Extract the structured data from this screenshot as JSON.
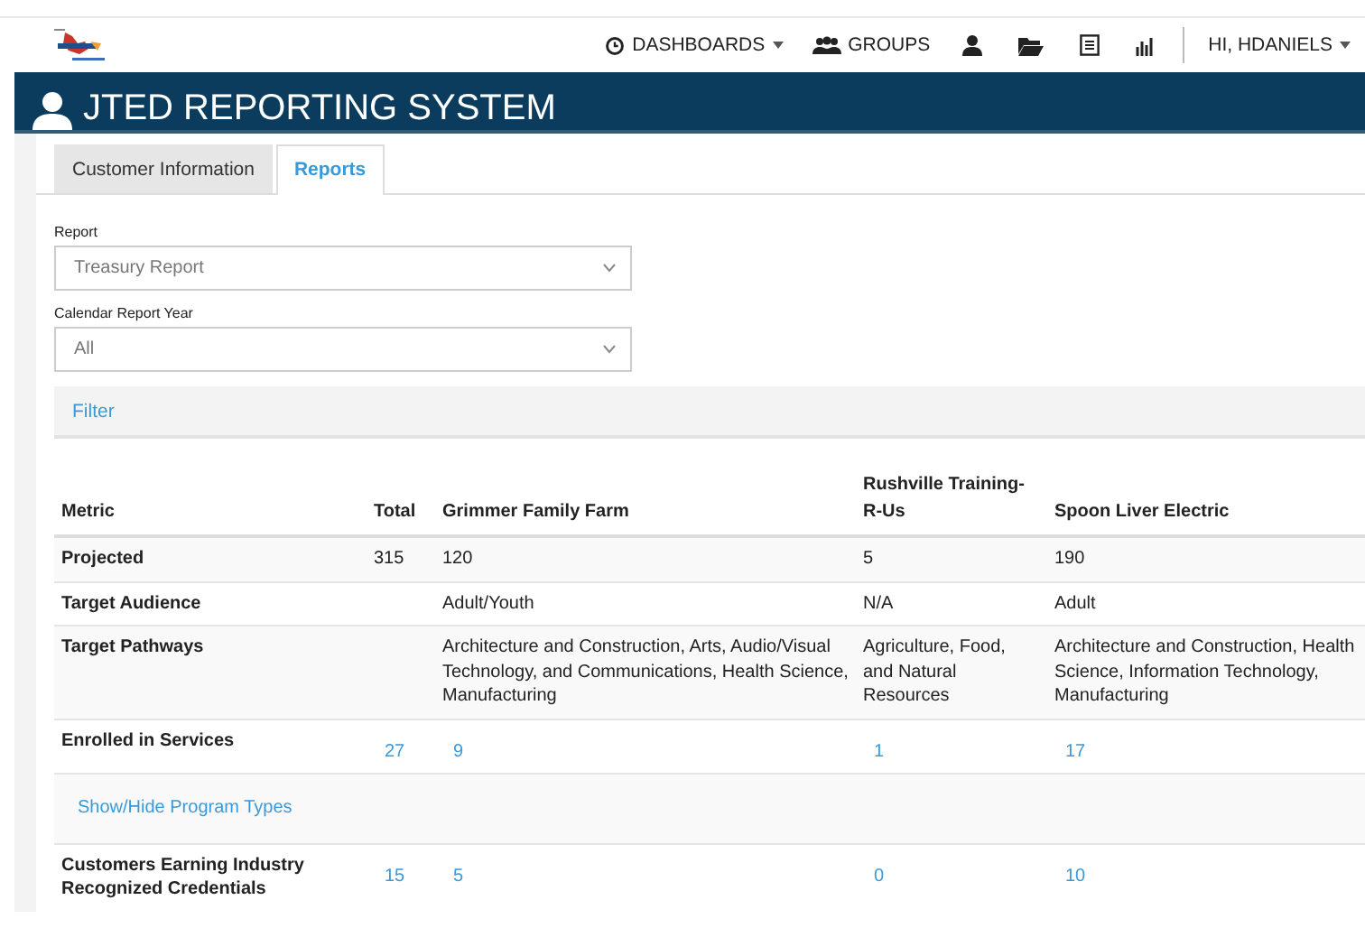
{
  "nav": {
    "items": [
      {
        "kind": "dashboards",
        "label": "DASHBOARDS",
        "caret": true
      },
      {
        "kind": "groups",
        "label": "GROUPS",
        "caret": false
      },
      {
        "kind": "user"
      },
      {
        "kind": "folder"
      },
      {
        "kind": "list"
      },
      {
        "kind": "chart"
      }
    ],
    "user": {
      "label": "HI, HDANIELS",
      "caret": true
    }
  },
  "banner": {
    "title": "JTED REPORTING SYSTEM"
  },
  "tabs": [
    {
      "label": "Customer Information",
      "selected": false
    },
    {
      "label": "Reports",
      "selected": true
    }
  ],
  "fields": [
    {
      "label": "Report",
      "value": "Treasury Report"
    },
    {
      "label": "Calendar Report Year",
      "value": "All"
    }
  ],
  "filter": {
    "label": "Filter"
  },
  "table": {
    "columns": [
      "Metric",
      "Total",
      "Grimmer Family Farm",
      "Rushville Training-R-Us",
      "Spoon Liver Electric"
    ],
    "rows": [
      {
        "kind": "text",
        "metric": "Projected",
        "total": "315",
        "values": [
          "120",
          "5",
          "190"
        ]
      },
      {
        "kind": "text",
        "metric": "Target Audience",
        "values": [
          "Adult/Youth",
          "N/A",
          "Adult"
        ]
      },
      {
        "kind": "text",
        "metric": "Target Pathways",
        "values": [
          "Architecture and Construction, Arts, Audio/Visual Technology, and Communications, Health Science, Manufacturing",
          "Agriculture, Food, and Natural Resources",
          "Architecture and Construction, Health Science, Information Technology, Manufacturing"
        ]
      },
      {
        "kind": "link",
        "metric": "Enrolled in Services",
        "total": "27",
        "values": [
          "9",
          "1",
          "17"
        ]
      },
      {
        "kind": "toggle",
        "label": "Show/Hide Program Types"
      },
      {
        "kind": "link",
        "metric": "Customers Earning Industry Recognized Credentials",
        "total": "15",
        "values": [
          "5",
          "0",
          "10"
        ]
      }
    ]
  }
}
